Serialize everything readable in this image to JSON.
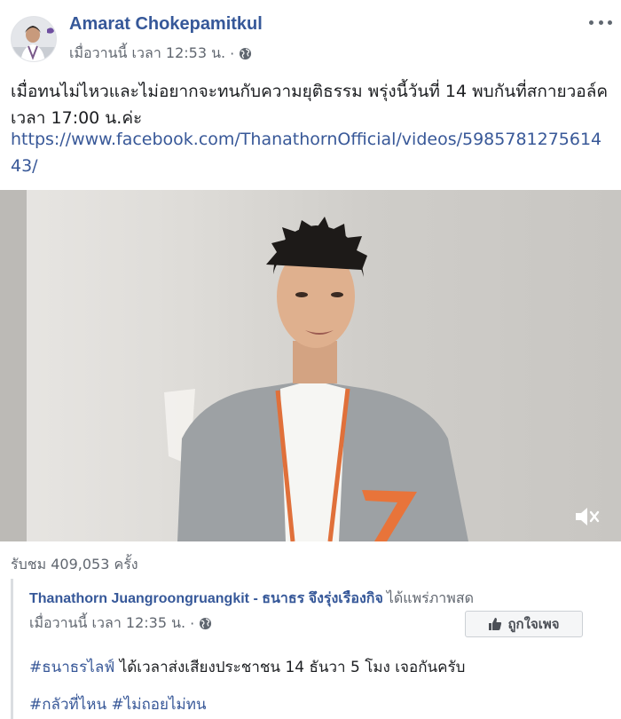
{
  "post": {
    "author": "Amarat Chokepamitkul",
    "time": "เมื่อวานนี้ เวลา 12:53 น.",
    "separator": "·",
    "text": "เมื่อทนไม่ไหวและไม่อยากจะทนกับความยุติธรรม พรุ่งนี้วันที่ 14 พบกันที่สกายวอล์คเวลา 17:00 น.ค่ะ",
    "link": "https://www.facebook.com/ThanathornOfficial/videos/598578127561443/",
    "views": "รับชม 409,053 ครั้ง"
  },
  "shared": {
    "author": "Thanathorn Juangroongruangkit - ธนาธร จึงรุ่งเรืองกิจ",
    "action": "ได้แพร่ภาพสด",
    "time": "เมื่อวานนี้ เวลา 12:35 น.",
    "separator": "·",
    "like_page_label": "ถูกใจเพจ",
    "hashtag1": "#ธนาธรไลฟ์",
    "line1_text": "ได้เวลาส่งเสียงประชาชน 14 ธันวา 5 โมง เจอกันครับ",
    "hashtag2": "#กลัวที่ไหน",
    "hashtag3": "#ไม่ถอยไม่ทน"
  },
  "icons": {
    "more": "more-options-icon",
    "globe": "globe-icon",
    "mute": "speaker-muted-icon",
    "like": "thumbs-up-icon"
  },
  "colors": {
    "link_blue": "#385898",
    "name_blue": "#365899",
    "meta_gray": "#616770"
  }
}
